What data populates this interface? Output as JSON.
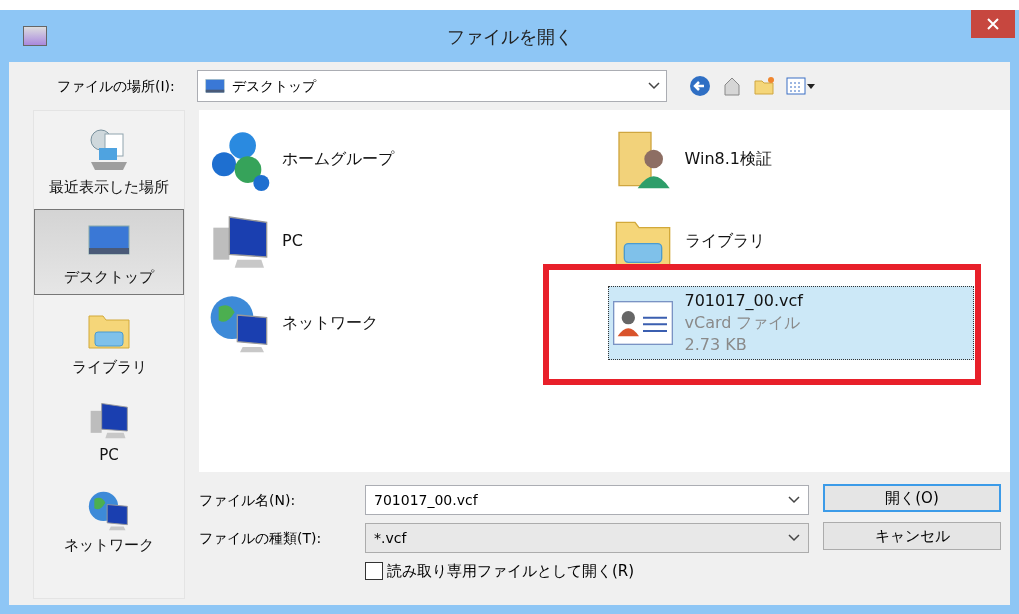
{
  "window": {
    "title": "ファイルを開く"
  },
  "location": {
    "label": "ファイルの場所(I):",
    "value": "デスクトップ"
  },
  "places": [
    {
      "label": "最近表示した場所",
      "kind": "recent",
      "selected": false
    },
    {
      "label": "デスクトップ",
      "kind": "desktop",
      "selected": true
    },
    {
      "label": "ライブラリ",
      "kind": "library",
      "selected": false
    },
    {
      "label": "PC",
      "kind": "pc",
      "selected": false
    },
    {
      "label": "ネットワーク",
      "kind": "network",
      "selected": false
    }
  ],
  "items": [
    {
      "name": "ホームグループ",
      "kind": "homegroup",
      "selected": false
    },
    {
      "name": "PC",
      "kind": "pc",
      "selected": false
    },
    {
      "name": "ネットワーク",
      "kind": "network",
      "selected": false
    },
    {
      "name": "Win8.1検証",
      "kind": "userfolder",
      "selected": false
    },
    {
      "name": "ライブラリ",
      "kind": "library",
      "selected": false
    },
    {
      "name": "701017_00.vcf",
      "kind": "vcard",
      "selected": true,
      "details": [
        "vCard ファイル",
        "2.73 KB"
      ]
    }
  ],
  "file_name": {
    "label": "ファイル名(N):",
    "value": "701017_00.vcf"
  },
  "file_type": {
    "label": "ファイルの種類(T):",
    "value": "*.vcf"
  },
  "read_only": {
    "label": "読み取り専用ファイルとして開く(R)",
    "checked": false
  },
  "buttons": [
    {
      "label": "開く(O)",
      "default": true
    },
    {
      "label": "キャンセル",
      "default": false
    }
  ]
}
